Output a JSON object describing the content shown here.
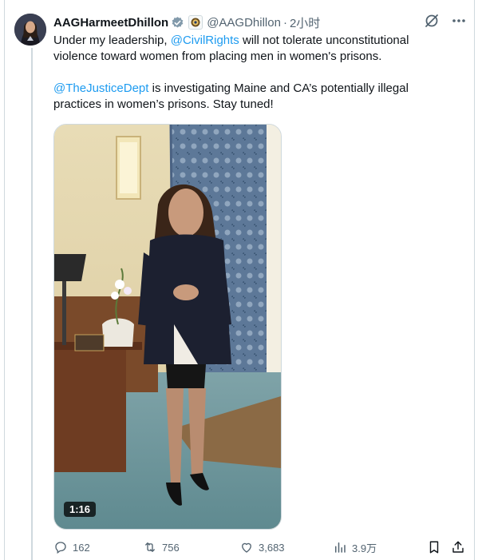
{
  "author": {
    "display_name": "AAGHarmeetDhillon",
    "handle": "@AAGDhillon",
    "time": "2小时"
  },
  "tweet": {
    "p1_before": "Under my leadership, ",
    "p1_mention": "@CivilRights",
    "p1_after": " will not tolerate unconstitutional violence toward women from placing men in women's prisons.",
    "p2_mention": "@TheJusticeDept",
    "p2_after": " is investigating Maine and CA’s potentially illegal practices in women’s prisons. Stay tuned!"
  },
  "media": {
    "duration": "1:16"
  },
  "actions": {
    "replies": "162",
    "reposts": "756",
    "likes": "3,683",
    "views": "3.9万"
  },
  "colors": {
    "accent": "#1d9bf0",
    "text": "#0f1419",
    "muted": "#536471",
    "verified_badge": "#829aab"
  },
  "icons": [
    "verified-badge-icon",
    "government-seal-icon",
    "grok-icon",
    "more-icon",
    "reply-icon",
    "repost-icon",
    "like-icon",
    "views-icon",
    "bookmark-icon",
    "share-icon"
  ]
}
